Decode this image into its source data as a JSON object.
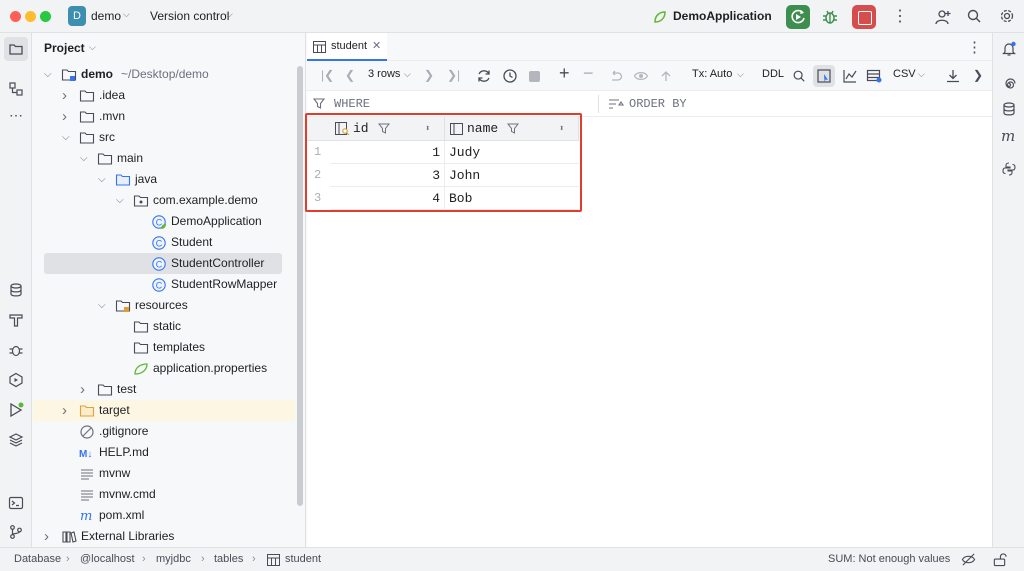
{
  "titlebar": {
    "project_initial": "D",
    "project_name": "demo",
    "vcs_label": "Version control",
    "run_config": "DemoApplication",
    "colors": {
      "run": "#3e8f4f",
      "stop": "#d64d4d",
      "accent": "#3574f0"
    }
  },
  "project_panel": {
    "title": "Project",
    "tree": [
      {
        "label": "demo",
        "suffix": "~/Desktop/demo",
        "depth": 0,
        "icon": "module-folder-icon",
        "expanded": true,
        "bold": true
      },
      {
        "label": ".idea",
        "depth": 1,
        "icon": "folder-icon",
        "expanded": false
      },
      {
        "label": ".mvn",
        "depth": 1,
        "icon": "folder-icon",
        "expanded": false
      },
      {
        "label": "src",
        "depth": 1,
        "icon": "folder-icon",
        "expanded": true
      },
      {
        "label": "main",
        "depth": 2,
        "icon": "folder-icon",
        "expanded": true
      },
      {
        "label": "java",
        "depth": 3,
        "icon": "source-folder-icon",
        "expanded": true
      },
      {
        "label": "com.example.demo",
        "depth": 4,
        "icon": "package-icon",
        "expanded": true
      },
      {
        "label": "DemoApplication",
        "depth": 5,
        "icon": "spring-class-icon"
      },
      {
        "label": "Student",
        "depth": 5,
        "icon": "class-icon"
      },
      {
        "label": "StudentController",
        "depth": 5,
        "icon": "class-icon",
        "selected": true
      },
      {
        "label": "StudentRowMapper",
        "depth": 5,
        "icon": "class-icon"
      },
      {
        "label": "resources",
        "depth": 3,
        "icon": "resources-folder-icon",
        "expanded": true
      },
      {
        "label": "static",
        "depth": 4,
        "icon": "folder-icon"
      },
      {
        "label": "templates",
        "depth": 4,
        "icon": "folder-icon"
      },
      {
        "label": "application.properties",
        "depth": 4,
        "icon": "spring-properties-icon"
      },
      {
        "label": "test",
        "depth": 2,
        "icon": "folder-icon",
        "expanded": false
      },
      {
        "label": "target",
        "depth": 1,
        "icon": "excluded-folder-icon",
        "expanded": false,
        "highlight": true
      },
      {
        "label": ".gitignore",
        "depth": 1,
        "icon": "ignore-file-icon"
      },
      {
        "label": "HELP.md",
        "depth": 1,
        "icon": "markdown-icon"
      },
      {
        "label": "mvnw",
        "depth": 1,
        "icon": "text-file-icon"
      },
      {
        "label": "mvnw.cmd",
        "depth": 1,
        "icon": "text-file-icon"
      },
      {
        "label": "pom.xml",
        "depth": 1,
        "icon": "maven-icon"
      },
      {
        "label": "External Libraries",
        "depth": 0,
        "icon": "library-icon",
        "expanded": false
      }
    ]
  },
  "editor": {
    "tab_label": "student",
    "rows_label": "3 rows",
    "tx_label": "Tx: Auto",
    "ddl_label": "DDL",
    "format_label": "CSV",
    "where_label": "WHERE",
    "orderby_label": "ORDER BY",
    "columns": [
      {
        "name": "id",
        "icon": "key-column-icon"
      },
      {
        "name": "name",
        "icon": "column-icon"
      }
    ],
    "rows": [
      {
        "num": "1",
        "id": "1",
        "name": "Judy"
      },
      {
        "num": "2",
        "id": "3",
        "name": "John"
      },
      {
        "num": "3",
        "id": "4",
        "name": "Bob"
      }
    ]
  },
  "statusbar": {
    "crumbs": [
      "Database",
      "@localhost",
      "myjdbc",
      "tables",
      "student"
    ],
    "sum_text": "SUM: Not enough values"
  }
}
